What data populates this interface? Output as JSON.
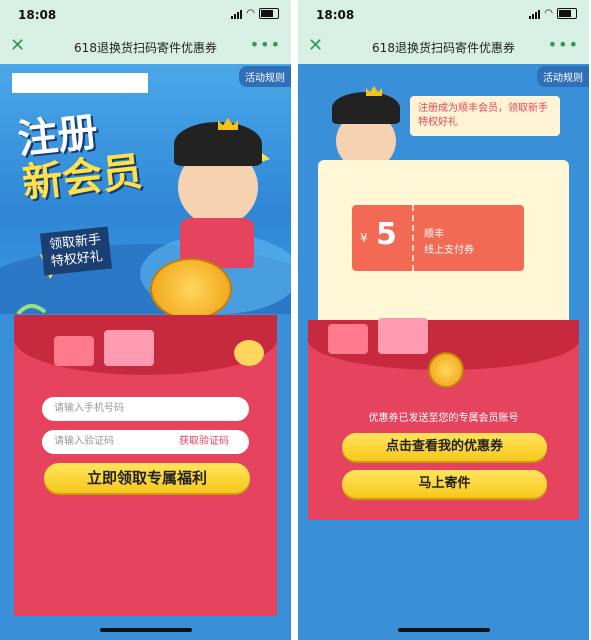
{
  "status": {
    "time": "18:08"
  },
  "nav": {
    "title": "618退换货扫码寄件优惠券",
    "close_icon": "close-icon",
    "more_icon": "more-icon"
  },
  "rules_tab": "活动规则",
  "left": {
    "title_line1": "注册",
    "title_line2": "新会员",
    "subtitle_line1": "领取新手",
    "subtitle_line2": "特权好礼",
    "phone_placeholder": "请输入手机号码",
    "code_placeholder": "请输入验证码",
    "get_code_label": "获取验证码",
    "claim_button": "立即领取专属福利"
  },
  "right": {
    "bubble_text": "注册成为顺丰会员，领取新手特权好礼",
    "coupon": {
      "currency": "¥",
      "amount": "5",
      "line1": "顺丰",
      "line2": "线上支付券"
    },
    "sent_text": "优惠券已发送至您的专属会员账号",
    "view_button": "点击查看我的优惠券",
    "ship_button": "马上寄件"
  },
  "colors": {
    "accent_red": "#e6445e",
    "button_yellow": "#f7c81b",
    "sky_blue": "#3a8fd9",
    "nav_green": "#2b9a5a"
  }
}
